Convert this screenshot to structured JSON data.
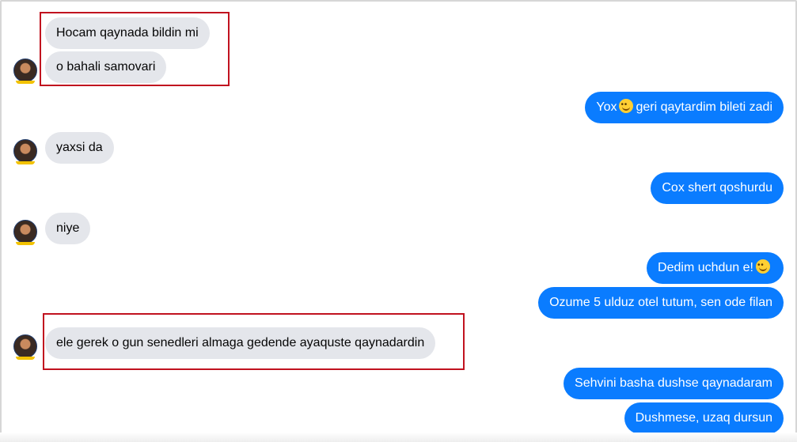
{
  "conversation": {
    "received": [
      {
        "text": "Hocam qaynada bildin mi"
      },
      {
        "text": "o bahali samovari"
      },
      {
        "text": "yaxsi da"
      },
      {
        "text": "niye"
      },
      {
        "text": "ele gerek o gun senedleri almaga gedende ayaquste qaynadardin"
      }
    ],
    "sent": [
      {
        "before": "Yox",
        "emoji": "smile-emoji-icon",
        "after": "geri qaytardim bileti zadi"
      },
      {
        "text": "Cox shert qoshurdu"
      },
      {
        "before": "Dedim uchdun e!",
        "emoji": "smile-emoji-icon",
        "after": ""
      },
      {
        "text": "Ozume 5 ulduz otel tutum, sen ode filan"
      },
      {
        "text": "Sehvini basha dushse qaynadaram"
      },
      {
        "text": "Dushmese, uzaq dursun"
      }
    ]
  },
  "colors": {
    "received_bubble": "#e4e6eb",
    "sent_bubble": "#0a7cff",
    "highlight_box": "#c1121f"
  }
}
